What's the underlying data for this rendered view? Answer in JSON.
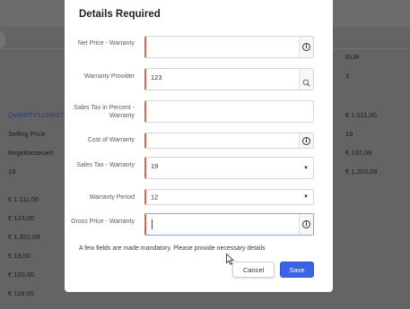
{
  "background": {
    "currency": "EUR",
    "right_col": [
      "1",
      "€ 1.011,00",
      "19",
      "€ 192,09",
      "€ 1.203,09"
    ],
    "left_link": "QWERTY12345678",
    "left_labels": [
      "Selling Price",
      "Regelbesteuert",
      "19"
    ],
    "left_values": [
      "€ 1.111,00",
      "€ 123,00",
      "€ 1.322,09",
      "€ 19,00",
      "€ 100,00",
      "€ 119,00"
    ]
  },
  "dialog": {
    "title": "Details Required",
    "fields": [
      {
        "label": "Net Price - Warranty",
        "value": "",
        "icon": "info-icon"
      },
      {
        "label": "Warranty Provider",
        "value": "123",
        "icon": "search-icon"
      },
      {
        "label": "Sales Tax in Percent - Warranty",
        "value": ""
      },
      {
        "label": "Cost of Warranty",
        "value": "",
        "icon": "info-icon"
      },
      {
        "label": "Sales Tax - Warranty",
        "value": "19",
        "icon": "caret-down-icon"
      },
      {
        "label": "Warranty Period",
        "value": "12",
        "icon": "caret-down-icon"
      },
      {
        "label": "Gross Price - Warranty",
        "value": "",
        "icon": "info-icon"
      }
    ],
    "note": "A few fields are made mandatory. Please provide necessary details",
    "cancel_label": "Cancel",
    "save_label": "Save"
  },
  "colors": {
    "overlay": "#646464",
    "required_marker": "#e8614b",
    "primary": "#3a63e6",
    "link": "#2b3c86"
  }
}
